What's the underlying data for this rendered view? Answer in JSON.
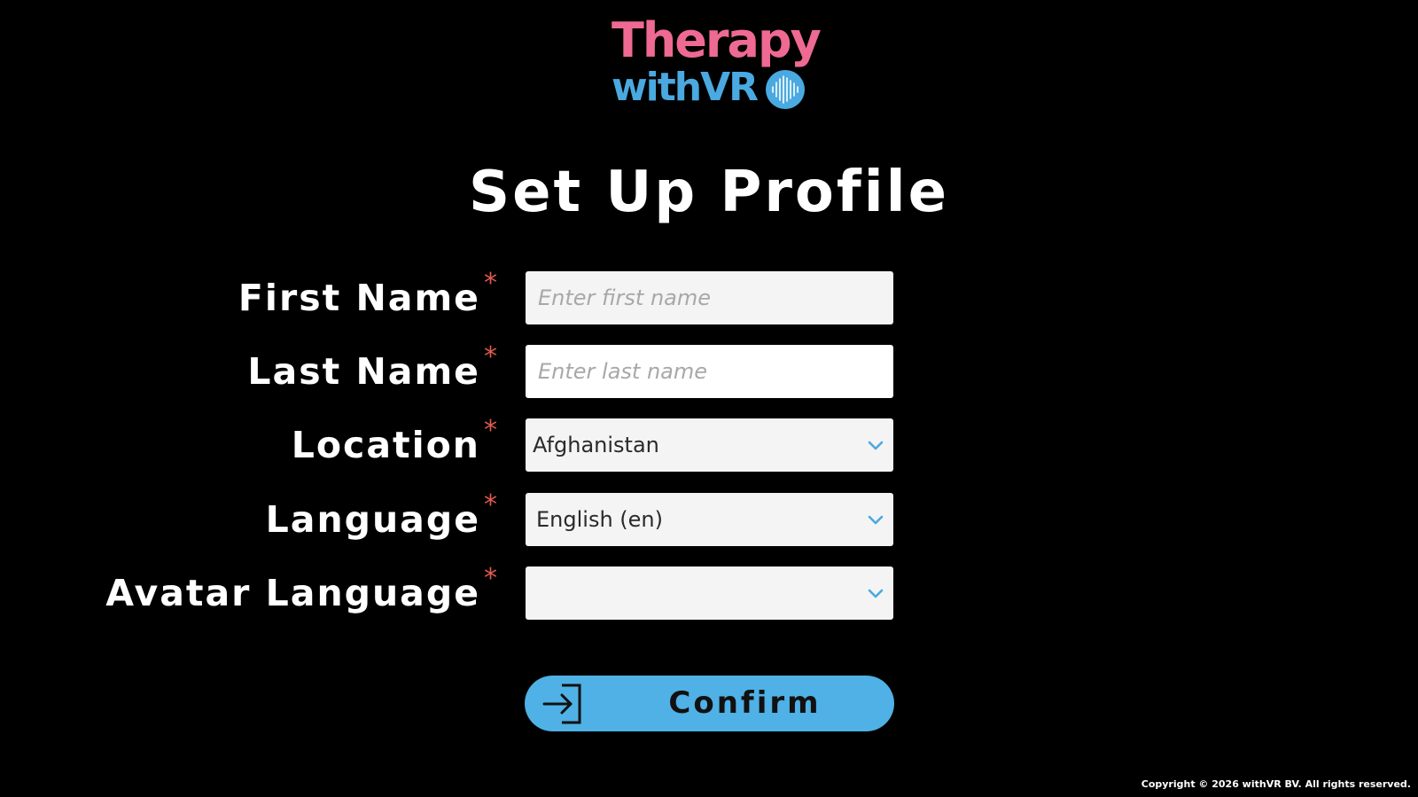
{
  "logo": {
    "line1": "Therapy",
    "line2": "withVR",
    "icon": "waveform-circle-icon",
    "colors": {
      "therapy": "#ee6a93",
      "withvr": "#4aa9e0"
    }
  },
  "page_title": "Set Up Profile",
  "form": {
    "first_name": {
      "label": "First Name",
      "required": "*",
      "placeholder": "Enter first name",
      "value": ""
    },
    "last_name": {
      "label": "Last Name",
      "required": "*",
      "placeholder": "Enter last name",
      "value": ""
    },
    "location": {
      "label": "Location",
      "required": "*",
      "selected": "Afghanistan",
      "icon": "chevron-down-icon"
    },
    "language": {
      "label": "Language",
      "required": "*",
      "selected": "English (en)",
      "icon": "chevron-down-icon"
    },
    "avatar_language": {
      "label": "Avatar Language",
      "required": "*",
      "selected": "",
      "icon": "chevron-down-icon"
    }
  },
  "confirm": {
    "label": "Confirm",
    "icon": "sign-in-icon",
    "color": "#4fb1e5"
  },
  "footer": {
    "copyright": "Copyright © 2026 withVR BV. All rights reserved."
  },
  "colors": {
    "background": "#000000",
    "required": "#e05a4f",
    "accent": "#4fb1e5"
  }
}
